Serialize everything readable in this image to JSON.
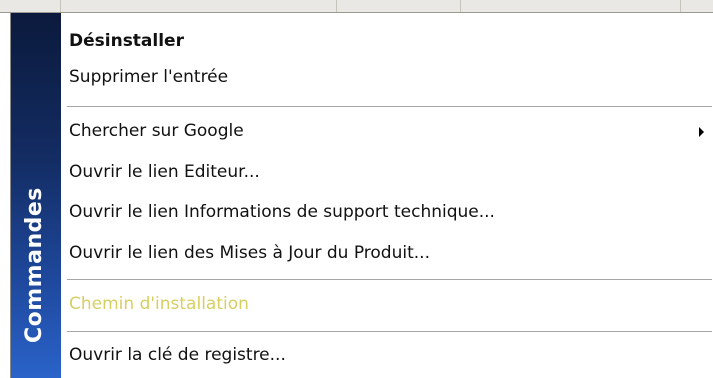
{
  "sidebar": {
    "title": "Commandes"
  },
  "menu": {
    "items": [
      {
        "label": "Désinstaller"
      },
      {
        "label": "Supprimer l'entrée"
      },
      {
        "label": "Chercher sur Google",
        "submenu_icon": "submenu-arrow-icon"
      },
      {
        "label": "Ouvrir le lien Editeur..."
      },
      {
        "label": "Ouvrir le lien Informations de support technique..."
      },
      {
        "label": "Ouvrir le lien des Mises à Jour du Produit..."
      },
      {
        "label": "Chemin d'installation",
        "state": "disabled"
      },
      {
        "label": "Ouvrir la clé de registre..."
      }
    ]
  },
  "colors": {
    "sidebar_top": "#0b1a3c",
    "sidebar_bottom": "#2a63c9",
    "disabled_text": "#d7cf61"
  }
}
